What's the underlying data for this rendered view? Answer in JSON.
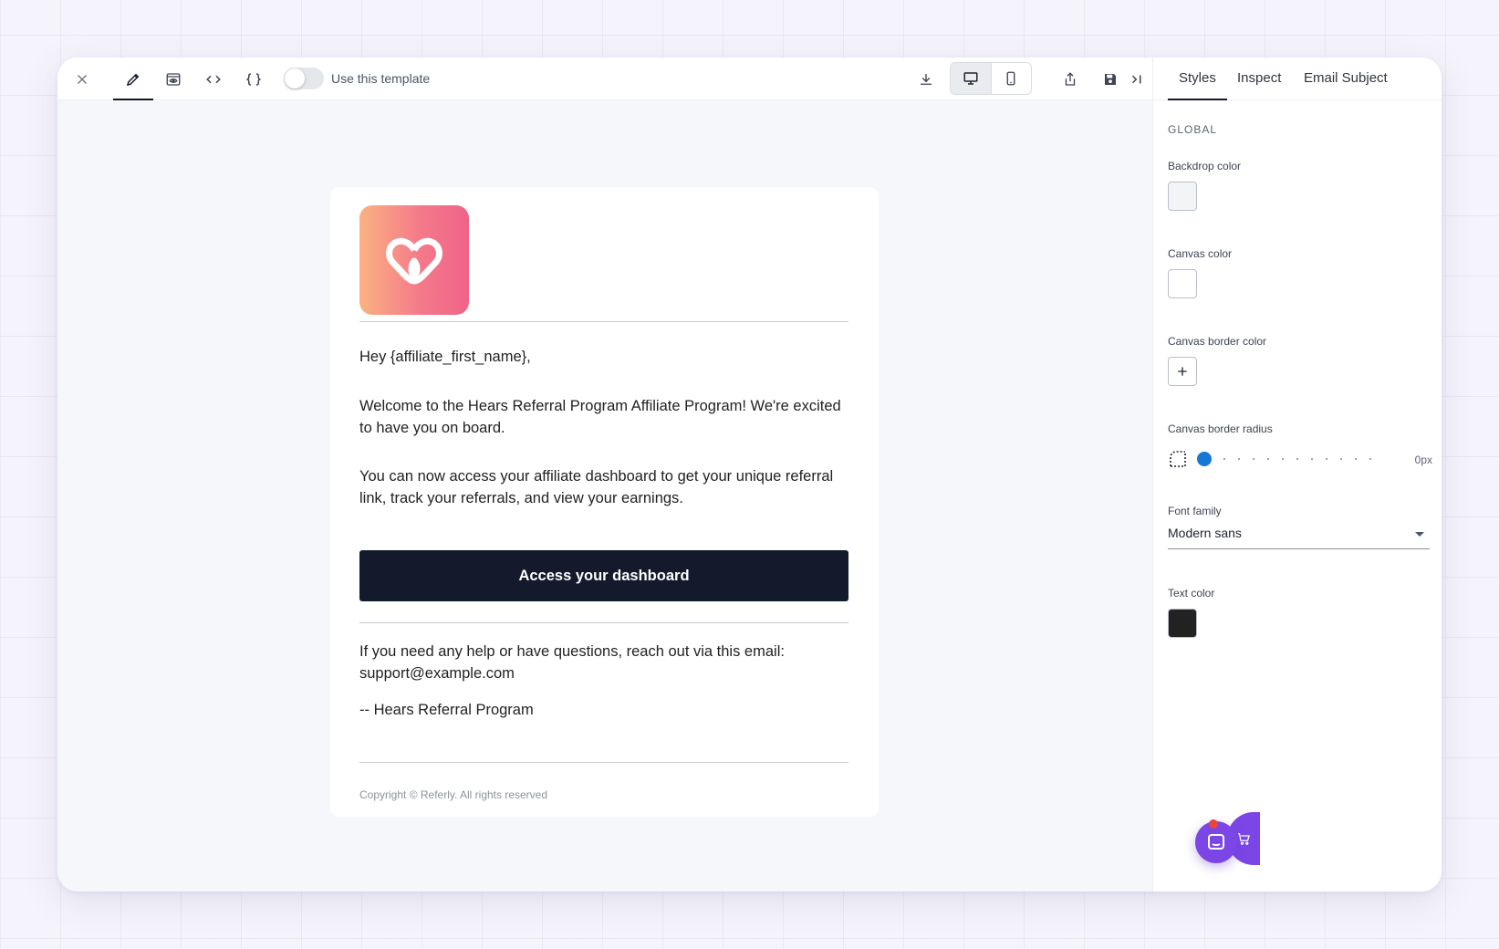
{
  "toolbar": {
    "toggle_label": "Use this template"
  },
  "panel": {
    "tabs": [
      "Styles",
      "Inspect",
      "Email Subject"
    ],
    "section": "GLOBAL",
    "backdrop_label": "Backdrop color",
    "backdrop_color": "#f3f4f6",
    "canvas_label": "Canvas color",
    "canvas_color": "#ffffff",
    "border_color_label": "Canvas border color",
    "border_radius_label": "Canvas border radius",
    "border_radius_value": "0px",
    "border_radius_level": 0,
    "font_label": "Font family",
    "font_value": "Modern sans",
    "text_color_label": "Text color",
    "text_color": "#222222"
  },
  "email": {
    "greeting": "Hey {affiliate_first_name},",
    "para1": "Welcome to the Hears Referral Program Affiliate Program! We're excited to have you on board.",
    "para2": "You can now access your affiliate dashboard to get your unique referral link, track your referrals, and view your earnings.",
    "cta": "Access your dashboard",
    "help": "If you need any help or have questions, reach out via this email: support@example.com",
    "signoff": "-- Hears Referral Program",
    "copyright": "Copyright © Referly. All rights reserved"
  },
  "colors": {
    "cta_bg": "#131a2c",
    "accent": "#1677d4",
    "chat": "#7c46e6",
    "logo_gradient": [
      "#fbb282",
      "#ef6388"
    ]
  }
}
